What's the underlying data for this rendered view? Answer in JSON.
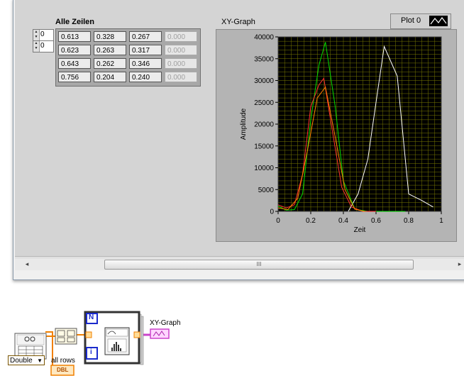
{
  "front_panel": {
    "array": {
      "label": "Alle Zeilen",
      "row_index": "0",
      "col_index": "0",
      "rows": [
        [
          "0.613",
          "0.328",
          "0.267",
          "0.000"
        ],
        [
          "0.623",
          "0.263",
          "0.317",
          "0.000"
        ],
        [
          "0.643",
          "0.262",
          "0.346",
          "0.000"
        ],
        [
          "0.756",
          "0.204",
          "0.240",
          "0.000"
        ]
      ]
    },
    "graph": {
      "label": "XY-Graph",
      "legend": {
        "plot_name": "Plot 0"
      },
      "colors": {
        "background": "#000000",
        "grid": "#7a7a00",
        "plot_area_border": "#444444"
      }
    },
    "scrollbar": {
      "grip_label": "III",
      "left_arrow": "◂",
      "right_arrow": "▸"
    }
  },
  "chart_data": {
    "type": "line",
    "title": "",
    "xlabel": "Zeit",
    "ylabel": "Amplitude",
    "xlim": [
      0,
      1
    ],
    "ylim": [
      0,
      40000
    ],
    "x_ticks": [
      "0",
      "0.2",
      "0.4",
      "0.6",
      "0.8",
      "1"
    ],
    "y_ticks": [
      "0",
      "5000",
      "10000",
      "15000",
      "20000",
      "25000",
      "30000",
      "35000",
      "40000"
    ],
    "grid": true,
    "series": [
      {
        "color": "#ffffff",
        "x": [
          0.43,
          0.49,
          0.55,
          0.6,
          0.65,
          0.73,
          0.8,
          0.88,
          0.95
        ],
        "y": [
          0,
          4000,
          12000,
          25000,
          37800,
          31000,
          4000,
          2500,
          1000
        ]
      },
      {
        "color": "#00dd00",
        "x": [
          0.0,
          0.05,
          0.1,
          0.15,
          0.2,
          0.25,
          0.29,
          0.35,
          0.4,
          0.47,
          0.55,
          0.62,
          0.7,
          0.78
        ],
        "y": [
          1200,
          300,
          400,
          4000,
          21000,
          33500,
          38800,
          24000,
          7000,
          500,
          0,
          0,
          0,
          0
        ]
      },
      {
        "color": "#ff3030",
        "x": [
          0.0,
          0.05,
          0.1,
          0.15,
          0.2,
          0.25,
          0.28,
          0.33,
          0.39,
          0.45,
          0.52,
          0.6
        ],
        "y": [
          1500,
          800,
          1500,
          8500,
          24000,
          29000,
          30500,
          19000,
          5500,
          1000,
          0,
          0
        ]
      },
      {
        "color": "#ff8000",
        "x": [
          0.0,
          0.06,
          0.12,
          0.18,
          0.24,
          0.29,
          0.35,
          0.41,
          0.47,
          0.53
        ],
        "y": [
          800,
          400,
          3000,
          14000,
          26000,
          28500,
          17000,
          5000,
          500,
          0
        ]
      }
    ]
  },
  "block_diagram": {
    "graph_terminal_label": "XY-Graph",
    "graph_terminal_icon": "xy-graph-terminal-icon",
    "constant_label": "all rows",
    "constant_terminal": "DBL",
    "type_selector": "Double",
    "loop_count": "N",
    "loop_iteration": "i",
    "colors": {
      "wire_orange": "#f08000",
      "wire_pink": "#cc44cc",
      "loop_border": "#1a2acc"
    }
  }
}
